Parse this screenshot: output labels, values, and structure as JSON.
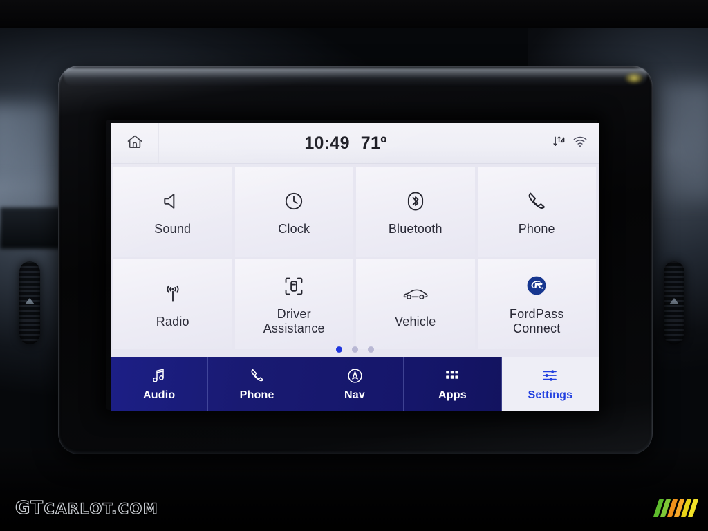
{
  "device": {
    "name": "ford-sync-touchscreen",
    "knob_left": "volume-knob",
    "knob_right": "tune-knob"
  },
  "statusbar": {
    "home_icon": "home-icon",
    "time": "10:49",
    "temperature": "71º",
    "data_icon": "data-transfer-icon",
    "wifi_icon": "wifi-icon"
  },
  "settings_grid": {
    "tiles": [
      {
        "label": "Sound",
        "icon": "speaker-icon"
      },
      {
        "label": "Clock",
        "icon": "clock-icon"
      },
      {
        "label": "Bluetooth",
        "icon": "bluetooth-icon"
      },
      {
        "label": "Phone",
        "icon": "phone-handset-icon"
      },
      {
        "label": "Radio",
        "icon": "radio-antenna-icon"
      },
      {
        "label": "Driver\nAssistance",
        "icon": "driver-assistance-icon"
      },
      {
        "label": "Vehicle",
        "icon": "car-icon"
      },
      {
        "label": "FordPass\nConnect",
        "icon": "fordpass-logo-icon"
      }
    ],
    "pages": 3,
    "active_page": 1
  },
  "navbar": {
    "items": [
      {
        "label": "Audio",
        "icon": "music-note-icon",
        "active": false
      },
      {
        "label": "Phone",
        "icon": "phone-handset-icon",
        "active": false
      },
      {
        "label": "Nav",
        "icon": "navigation-compass-icon",
        "active": false
      },
      {
        "label": "Apps",
        "icon": "apps-grid-icon",
        "active": false
      },
      {
        "label": "Settings",
        "icon": "sliders-icon",
        "active": true
      }
    ]
  },
  "watermark": {
    "brand_primary": "GT",
    "brand_secondary": "CARLOT.COM",
    "stripe_colors": [
      "#5dbb2c",
      "#7ec837",
      "#f0911a",
      "#f7a82a",
      "#e8d318",
      "#f2e228"
    ]
  },
  "colors": {
    "accent_blue": "#2240e0",
    "navbar_blue": "#191a72",
    "screen_bg": "#e7e6f1",
    "tile_bg": "#f1f0f8",
    "active_dot": "#2036dd"
  }
}
